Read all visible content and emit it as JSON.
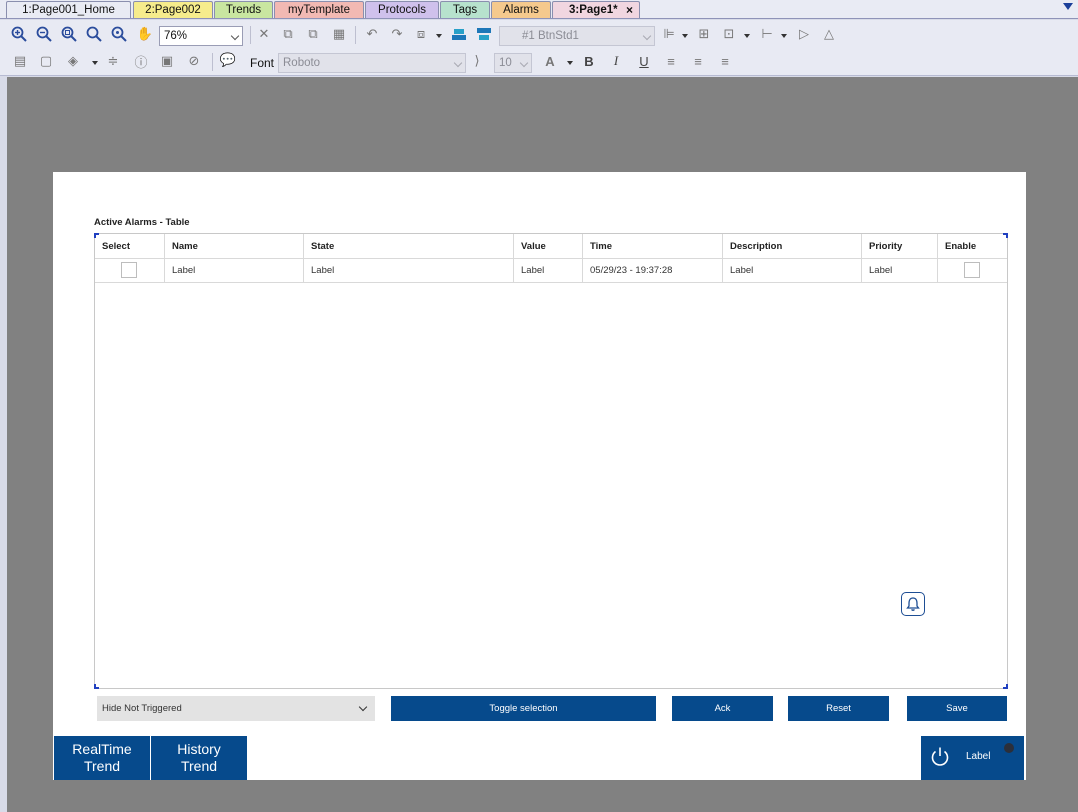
{
  "tabs": [
    {
      "label": "1:Page001_Home",
      "color": "#e9ebf4"
    },
    {
      "label": "2:Page002",
      "color": "#f6ec8c"
    },
    {
      "label": "Trends",
      "color": "#c9e6a0"
    },
    {
      "label": "myTemplate",
      "color": "#f2b9b3"
    },
    {
      "label": "Protocols",
      "color": "#cfc1ec"
    },
    {
      "label": "Tags",
      "color": "#b7e2cd"
    },
    {
      "label": "Alarms",
      "color": "#f5c98d"
    },
    {
      "label": "3:Page1*",
      "color": "#f1d6e0",
      "active": true,
      "close": "×"
    }
  ],
  "toolbar": {
    "zoom": "76%",
    "style_combo": "#1 BtnStd1",
    "font_label": "Font",
    "font_value": "Roboto",
    "font_size": "10",
    "bold": "B",
    "italic": "I",
    "underline": "U",
    "font_color_glyph": "A"
  },
  "screen": {
    "table_title": "Active Alarms - Table",
    "columns": [
      "Select",
      "Name",
      "State",
      "Value",
      "Time",
      "Description",
      "Priority",
      "Enable"
    ],
    "row": {
      "name": "Label",
      "state": "Label",
      "value": "Label",
      "time": "05/29/23 - 19:37:28",
      "description": "Label",
      "priority": "Label"
    },
    "filter_value": "Hide Not Triggered",
    "buttons": {
      "toggle": "Toggle selection",
      "ack": "Ack",
      "reset": "Reset",
      "save": "Save"
    },
    "nav": {
      "realtime_line1": "RealTime",
      "realtime_line2": "Trend",
      "history_line1": "History",
      "history_line2": "Trend"
    },
    "label_button": "Label"
  },
  "colors": {
    "accent": "#064a8c",
    "canvas": "#818181",
    "toolbar_bg": "#e8eaf3"
  }
}
